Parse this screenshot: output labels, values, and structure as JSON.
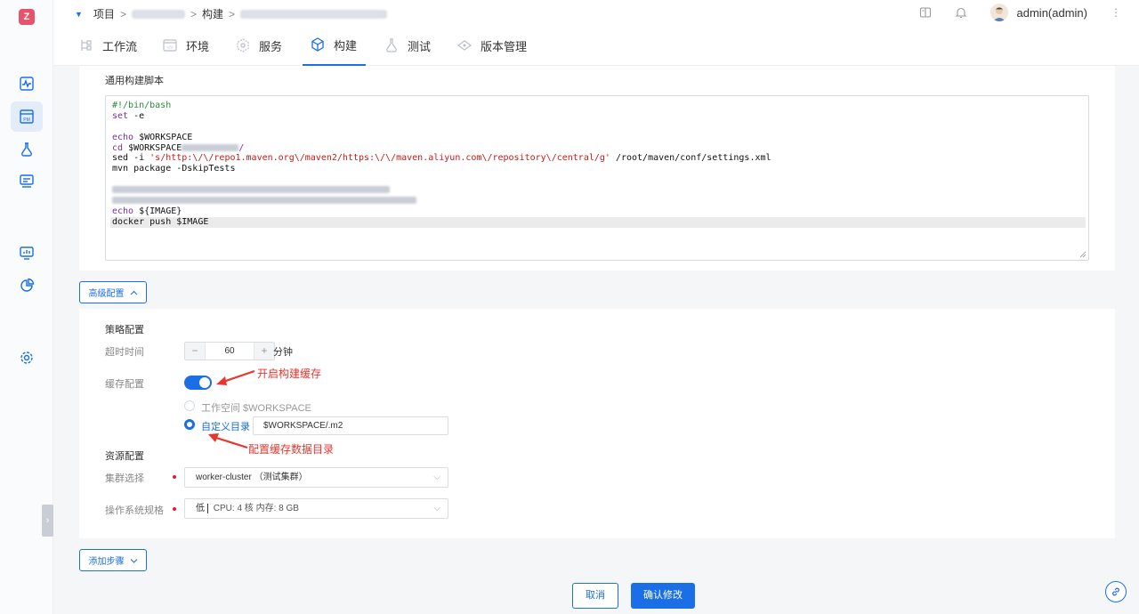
{
  "breadcrumb": {
    "project_label": "项目",
    "build_label": "构建",
    "sep": ">"
  },
  "user": {
    "name": "admin(admin)"
  },
  "tabs": [
    {
      "label": "工作流",
      "icon": "workflow-icon"
    },
    {
      "label": "环境",
      "icon": "environment-icon"
    },
    {
      "label": "服务",
      "icon": "service-icon"
    },
    {
      "label": "构建",
      "icon": "build-icon",
      "active": true
    },
    {
      "label": "测试",
      "icon": "test-flask-icon"
    },
    {
      "label": "版本管理",
      "icon": "version-icon"
    }
  ],
  "script": {
    "label": "通用构建脚本",
    "lines": {
      "l1": "#!/bin/bash",
      "l2a": "set",
      "l2b": " -e",
      "l4a": "echo",
      "l4b": " $WORKSPACE",
      "l5a": "cd",
      "l5b": " $WORKSPACE",
      "l5c": "/",
      "l6a": "sed",
      "l6b": " -i ",
      "l6c": "'s/http:\\/\\/repo1.maven.org\\/maven2/https:\\/\\/maven.aliyun.com\\/repository\\/central/g'",
      "l6d": " /root/maven/conf/settings.xml",
      "l7": "mvn package -DskipTests",
      "l10a": "echo",
      "l10b": " ${IMAGE}",
      "l11": "docker push $IMAGE"
    }
  },
  "advanced_button": {
    "label": "高级配置"
  },
  "policy": {
    "title": "策略配置",
    "timeout_label": "超时时间",
    "timeout_value": "60",
    "timeout_minus": "−",
    "timeout_plus": "+",
    "timeout_unit": "分钟",
    "cache_label": "缓存配置",
    "cache_enabled": true,
    "radio_workspace": "工作空间 $WORKSPACE",
    "radio_custom": "自定义目录",
    "custom_dir_value": "$WORKSPACE/.m2"
  },
  "resource": {
    "title": "资源配置",
    "cluster_label": "集群选择",
    "cluster_value": "worker-cluster （测试集群）",
    "os_label": "操作系统规格",
    "os_value_level": "低",
    "os_value_spec": "CPU: 4 核 内存: 8 GB"
  },
  "annotations": {
    "enable_cache": "开启构建缓存",
    "cache_dir": "配置缓存数据目录"
  },
  "add_step_button": {
    "label": "添加步骤"
  },
  "footer": {
    "cancel": "取消",
    "confirm": "确认修改"
  },
  "colors": {
    "accent": "#1a6ee6",
    "annotation": "#e8362f",
    "required": "#e11d2d"
  }
}
